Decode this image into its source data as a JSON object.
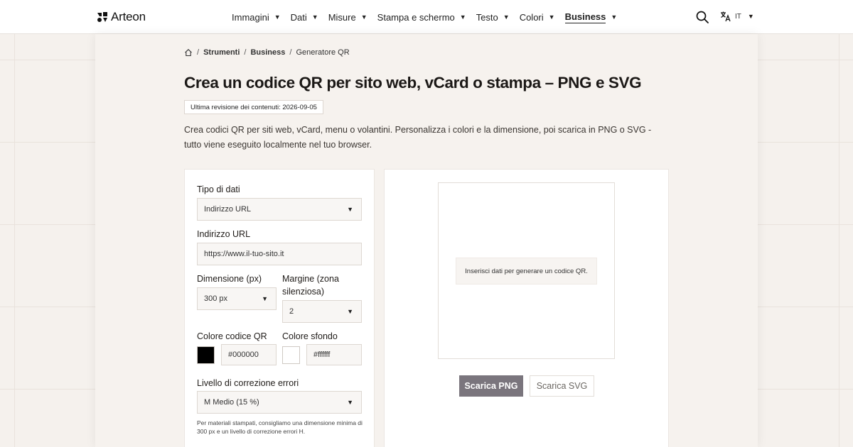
{
  "header": {
    "brand": "Arteon",
    "nav": [
      {
        "label": "Immagini"
      },
      {
        "label": "Dati"
      },
      {
        "label": "Misure"
      },
      {
        "label": "Stampa e schermo"
      },
      {
        "label": "Testo"
      },
      {
        "label": "Colori"
      },
      {
        "label": "Business",
        "active": true
      }
    ],
    "language": "IT",
    "icons": {
      "search": "search-icon",
      "language": "translate-icon",
      "home": "home-icon"
    }
  },
  "breadcrumb": {
    "sep": "/",
    "items": [
      "Strumenti",
      "Business"
    ],
    "current": "Generatore QR"
  },
  "page": {
    "title": "Crea un codice QR per sito web, vCard o stampa – PNG e SVG",
    "revision": "Ultima revisione dei contenuti: 2026-09-05",
    "intro": "Crea codici QR per siti web, vCard, menu o volantini. Personalizza i colori e la dimensione, poi scarica in PNG o SVG - tutto viene eseguito localmente nel tuo browser."
  },
  "form": {
    "data_type": {
      "label": "Tipo di dati",
      "value": "Indirizzo URL"
    },
    "url": {
      "label": "Indirizzo URL",
      "placeholder": "https://www.il-tuo-sito.it"
    },
    "size": {
      "label": "Dimensione (px)",
      "value": "300 px"
    },
    "margin": {
      "label": "Margine (zona silenziosa)",
      "value": "2"
    },
    "fg": {
      "label": "Colore codice QR",
      "value": "#000000",
      "color": "#000000"
    },
    "bg": {
      "label": "Colore sfondo",
      "value": "#ffffff",
      "color": "#ffffff"
    },
    "ecc": {
      "label": "Livello di correzione errori",
      "value": "M Medio (15 %)"
    },
    "hint": "Per materiali stampati, consigliamo una dimensione minima di 300 px e un livello di correzione errori H."
  },
  "preview": {
    "placeholder": "Inserisci dati per generare un codice QR.",
    "download_png": "Scarica PNG",
    "download_svg": "Scarica SVG"
  },
  "colors": {
    "accent_button": "#7a757d",
    "page_bg": "#f5f1ed"
  }
}
